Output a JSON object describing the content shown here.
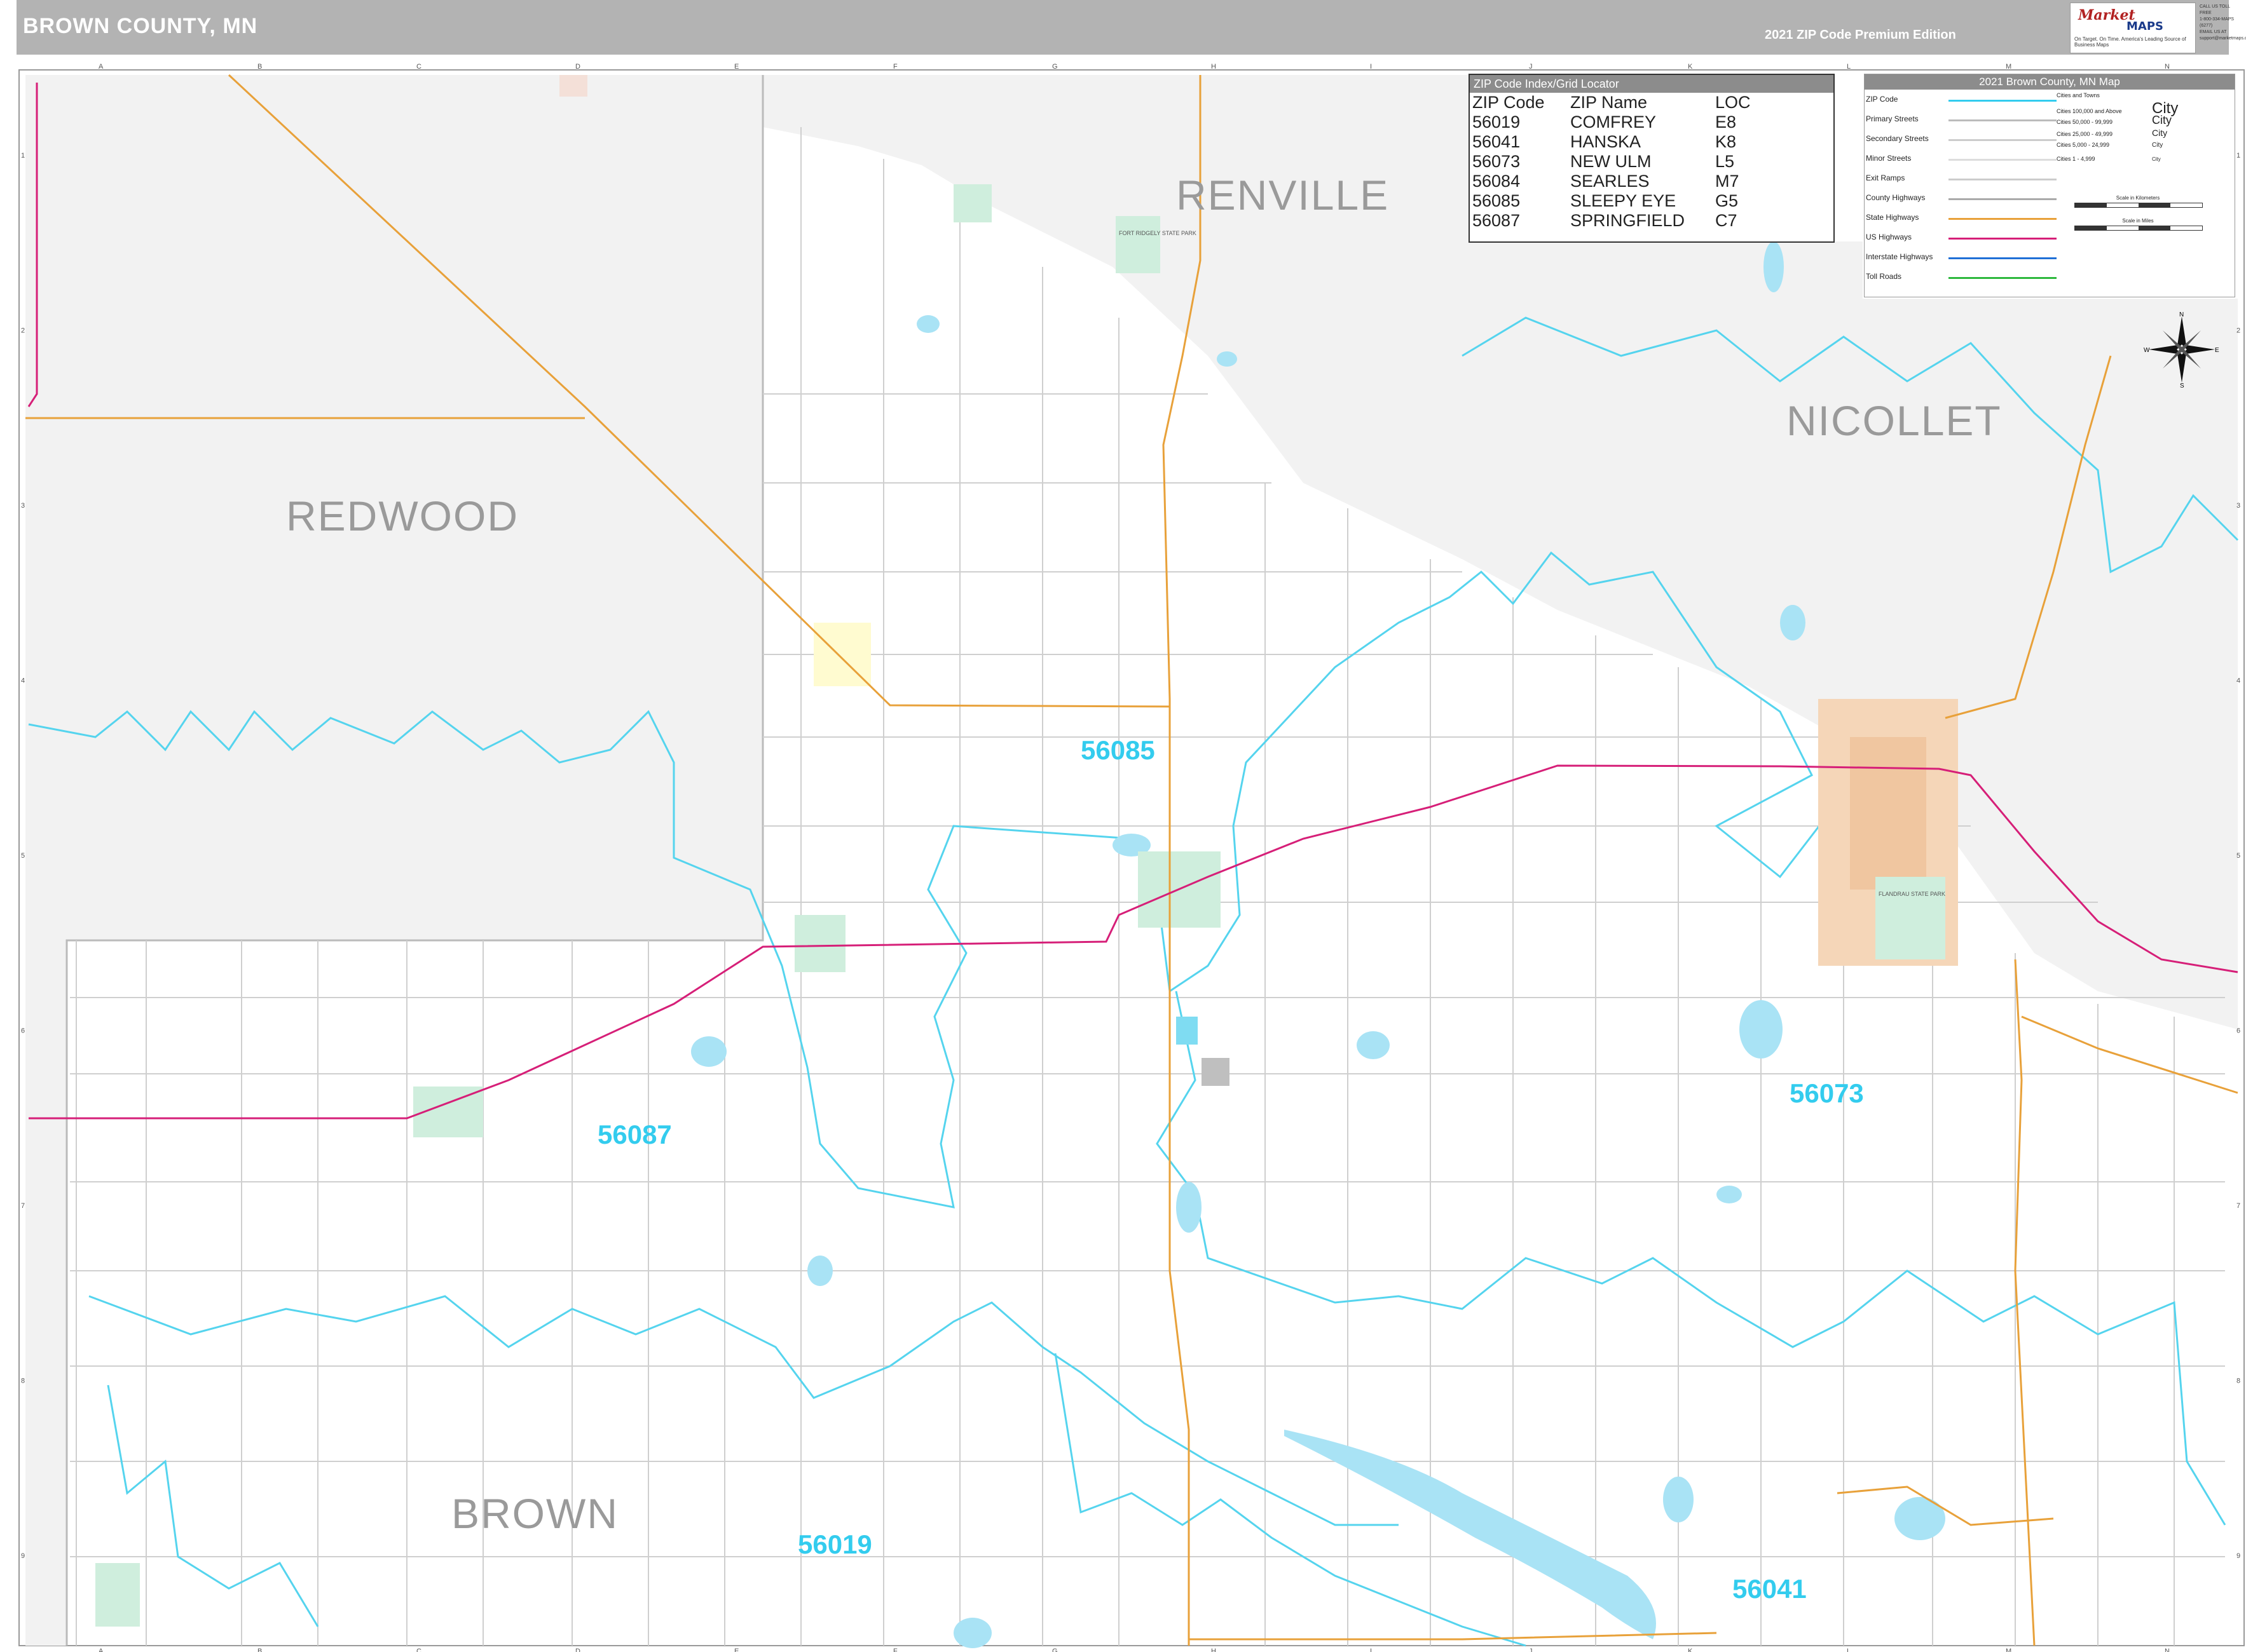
{
  "header": {
    "title": "BROWN COUNTY, MN",
    "edition": "2021 ZIP Code Premium Edition"
  },
  "brand": {
    "logo_main": "Market",
    "logo_sub": "MAPS",
    "tagline": "On Target. On Time. America's Leading Source of Business Maps",
    "contact": [
      "CALL US TOLL FREE",
      "1-800-334-MAPS (6277)",
      "EMAIL US AT",
      "support@marketmaps.com"
    ]
  },
  "grid": {
    "columns": [
      "A",
      "B",
      "C",
      "D",
      "E",
      "F",
      "G",
      "H",
      "I",
      "J",
      "K",
      "L",
      "M",
      "N"
    ],
    "rows": [
      "1",
      "2",
      "3",
      "4",
      "5",
      "6",
      "7",
      "8",
      "9"
    ]
  },
  "regions": {
    "redwood": "REDWOOD",
    "renville": "RENVILLE",
    "nicollet": "NICOLLET",
    "brown": "BROWN"
  },
  "zip_labels": {
    "z56085": "56085",
    "z56087": "56087",
    "z56073": "56073",
    "z56019": "56019",
    "z56041": "56041"
  },
  "place_labels": {
    "flandrau": "FLANDRAU STATE PARK",
    "fort_ridgely": "FORT RIDGELY STATE PARK"
  },
  "zip_index": {
    "title": "ZIP Code Index/Grid Locator",
    "headers": [
      "ZIP Code",
      "ZIP Name",
      "LOC"
    ],
    "rows": [
      [
        "56019",
        "COMFREY",
        "E8"
      ],
      [
        "56041",
        "HANSKA",
        "K8"
      ],
      [
        "56073",
        "NEW ULM",
        "L5"
      ],
      [
        "56084",
        "SEARLES",
        "M7"
      ],
      [
        "56085",
        "SLEEPY EYE",
        "G5"
      ],
      [
        "56087",
        "SPRINGFIELD",
        "C7"
      ]
    ]
  },
  "legend": {
    "title": "2021 Brown County, MN Map",
    "items": [
      {
        "label": "ZIP Code",
        "color": "#33ccee"
      },
      {
        "label": "Primary Streets",
        "color": "#bbbbbb"
      },
      {
        "label": "Secondary Streets",
        "color": "#cccccc"
      },
      {
        "label": "Minor Streets",
        "color": "#dddddd"
      },
      {
        "label": "Exit Ramps",
        "color": "#cccccc"
      },
      {
        "label": "County Highways",
        "color": "#aaaaaa"
      },
      {
        "label": "State Highways",
        "color": "#e8a13a"
      },
      {
        "label": "US Highways",
        "color": "#d61f78"
      },
      {
        "label": "Interstate Highways",
        "color": "#1f6fd6"
      },
      {
        "label": "Toll Roads",
        "color": "#2db83d"
      }
    ],
    "cities_heading": "Cities and Towns",
    "cities": [
      {
        "size": "Cities 100,000 and Above",
        "sample": "City"
      },
      {
        "size": "Cities 50,000 - 99,999",
        "sample": "City"
      },
      {
        "size": "Cities 25,000 - 49,999",
        "sample": "City"
      },
      {
        "size": "Cities 5,000 - 24,999",
        "sample": "City"
      },
      {
        "size": "Cities 1 - 4,999",
        "sample": "City"
      }
    ],
    "scale_km": "Scale in Kilometers",
    "scale_mi": "Scale in Miles"
  },
  "compass": {
    "n": "N",
    "s": "S",
    "e": "E",
    "w": "W"
  }
}
